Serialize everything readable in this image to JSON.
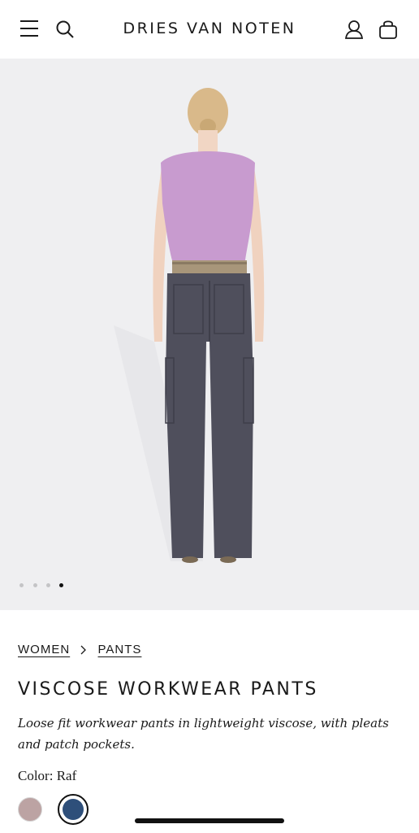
{
  "header": {
    "brand": "DRIES VAN NOTEN",
    "icons": [
      "menu-icon",
      "search-icon",
      "account-icon",
      "bag-icon"
    ]
  },
  "gallery": {
    "slide_count": 4,
    "active_slide": 4
  },
  "breadcrumb": {
    "level1": "WOMEN",
    "level2": "PANTS"
  },
  "product": {
    "title": "VISCOSE WORKWEAR PANTS",
    "description": "Loose fit workwear pants in lightweight viscose, with pleats and patch pockets.",
    "color_label": "Color: Raf"
  },
  "swatches": [
    {
      "color": "#bca3a3",
      "selected": false
    },
    {
      "color": "#2e4f7a",
      "selected": true
    }
  ]
}
